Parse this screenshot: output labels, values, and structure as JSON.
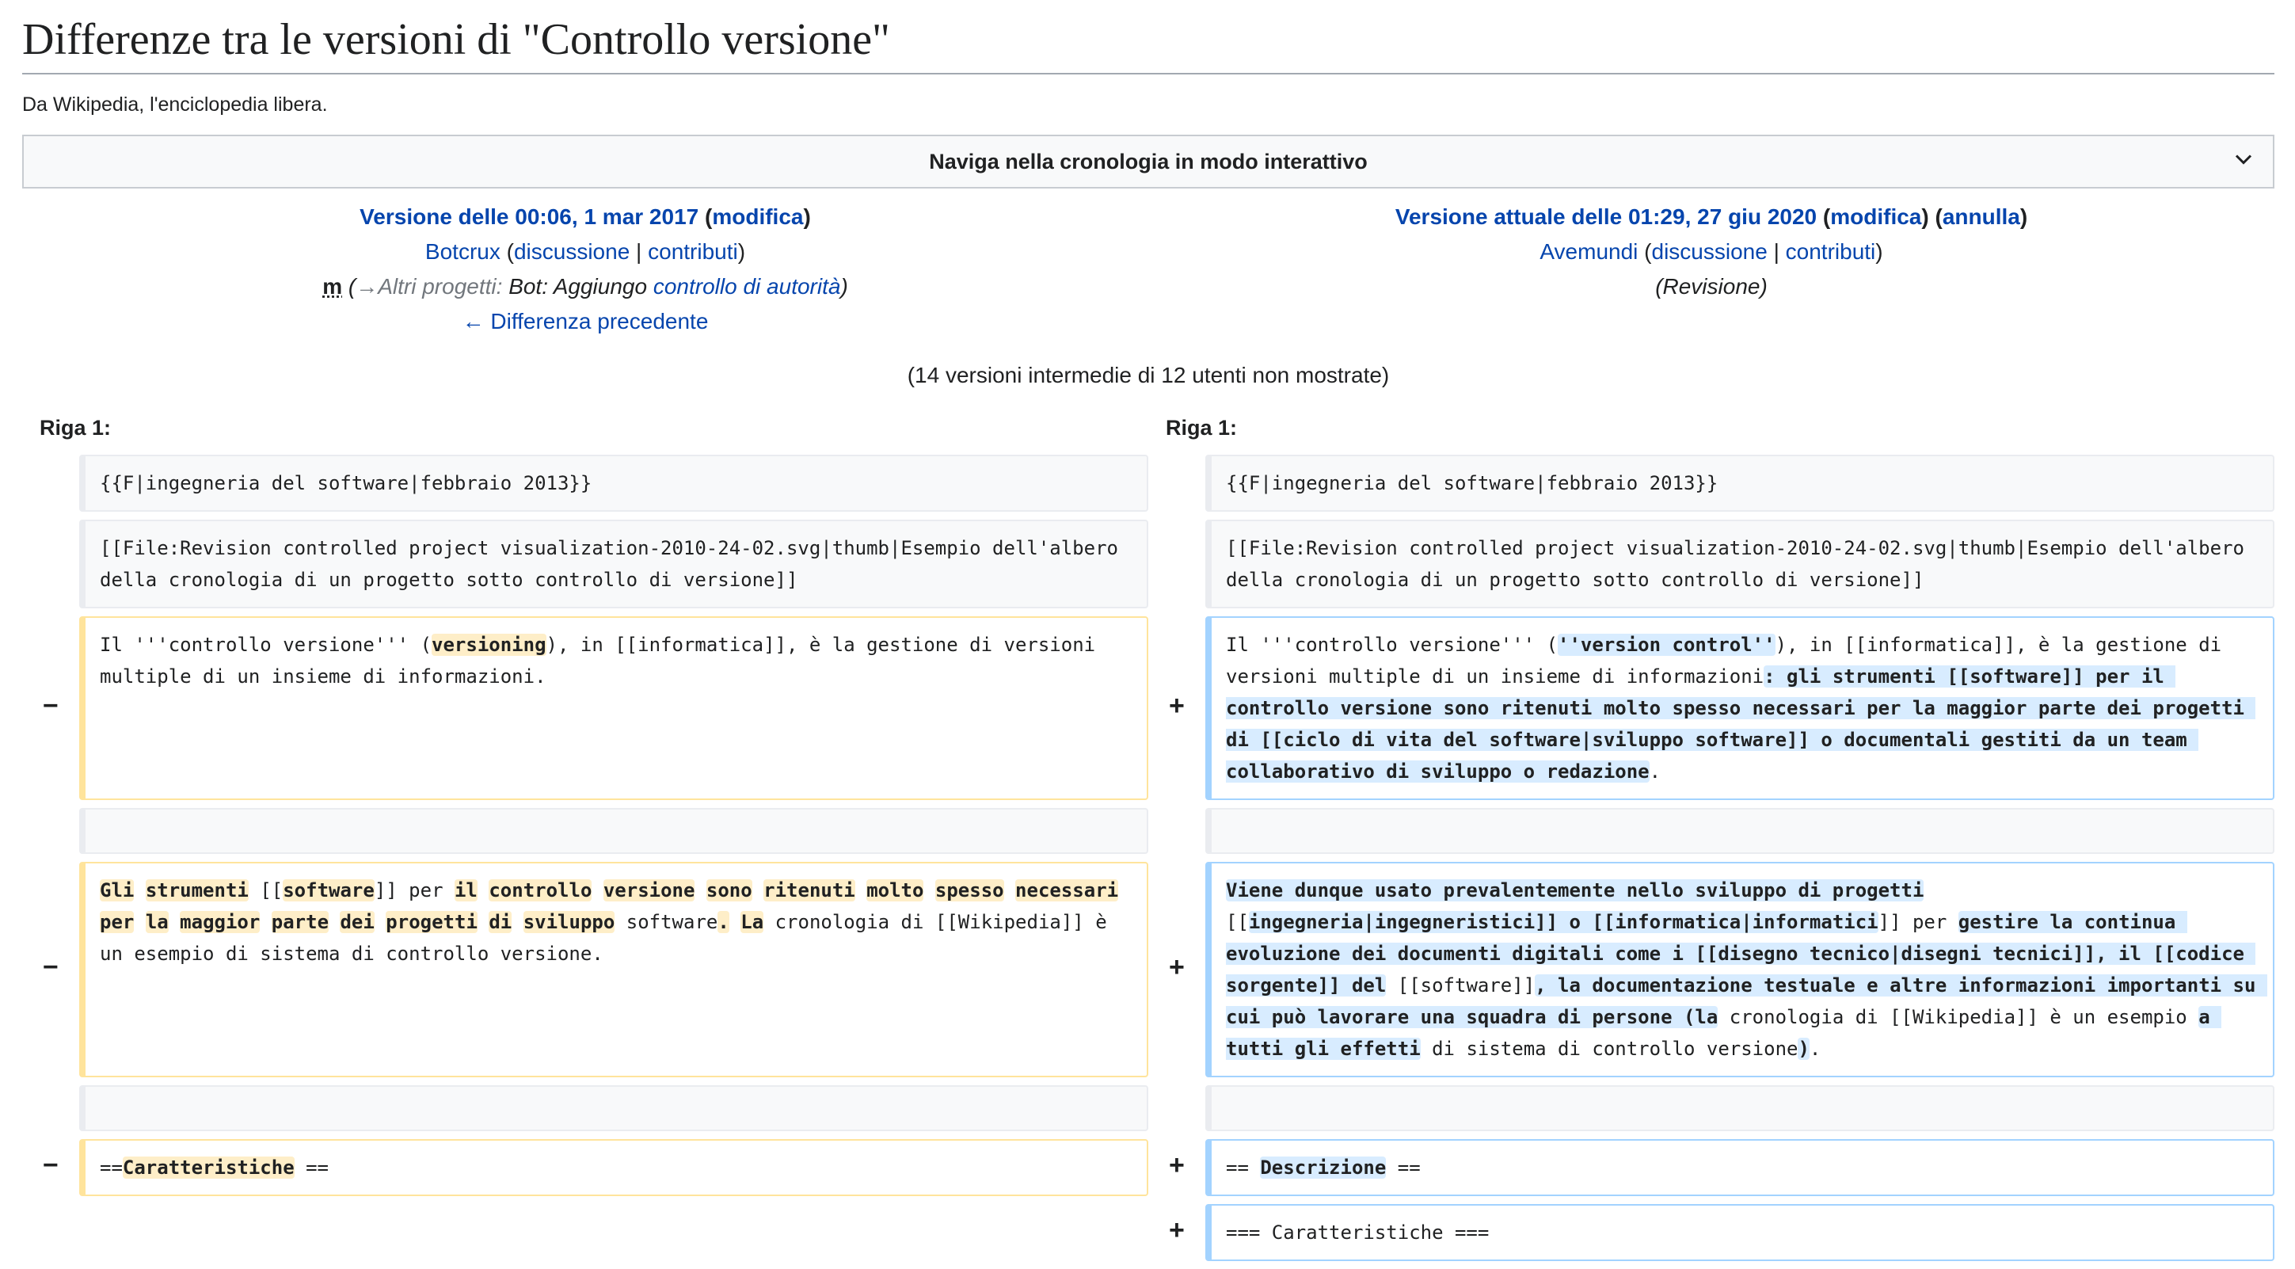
{
  "page": {
    "title": "Differenze tra le versioni di \"Controllo versione\"",
    "tagline": "Da Wikipedia, l'enciclopedia libera.",
    "navigate_label": "Naviga nella cronologia in modo interattivo"
  },
  "left": {
    "version_link": "Versione delle 00:06, 1 mar 2017",
    "edit_link": "modifica",
    "user": "Botcrux",
    "talk": "discussione",
    "contribs": "contributi",
    "minor": "m",
    "summary_arrow": "→",
    "summary_section": "Altri progetti:",
    "summary_text": "Bot: Aggiungo",
    "summary_link": "controllo di autorità",
    "prev_diff": "← Differenza precedente"
  },
  "right": {
    "version_link": "Versione attuale delle 01:29, 27 giu 2020",
    "edit_link": "modifica",
    "undo_link": "annulla",
    "user": "Avemundi",
    "talk": "discussione",
    "contribs": "contributi",
    "summary": "(Revisione)"
  },
  "intermediate": "(14 versioni intermedie di 12 utenti non mostrate)",
  "riga_label": "Riga 1:",
  "markers": {
    "minus": "−",
    "plus": "+"
  },
  "context": {
    "line1": "{{F|ingegneria del software|febbraio 2013}}",
    "line2": "[[File:Revision controlled project visualization-2010-24-02.svg|thumb|Esempio dell'albero della cronologia di un progetto sotto controllo di versione]]"
  },
  "del1": {
    "p1": "Il '''controllo versione''' (",
    "h1": "versioning",
    "p2": "), in [[informatica]], è la gestione di versioni multiple di un insieme di informazioni."
  },
  "add1": {
    "p1": "Il '''controllo versione''' (",
    "h1": "''version control''",
    "p2": "), in [[informatica]], è la gestione di versioni multiple di un insieme di informazioni",
    "h2": ": gli strumenti [[software]] per il controllo versione sono ritenuti molto spesso necessari per la maggior parte dei progetti di [[ciclo di vita del software|sviluppo software]] o documentali gestiti da un team collaborativo di sviluppo o redazione",
    "p3": "."
  },
  "del2": {
    "h1": "Gli",
    "h2": "strumenti",
    "h3": "software",
    "h4": "il",
    "h5": "controllo",
    "h6": "versione",
    "h7": "sono",
    "h8": "ritenuti",
    "h9": "molto",
    "h10": "spesso",
    "h11": "necessari",
    "h12": "per",
    "h13": "la",
    "h14": "maggior",
    "h15": "parte",
    "h16": "dei",
    "h17": "progetti",
    "h18": "di",
    "h19": "sviluppo",
    "h20": ".",
    "h21": "La",
    "t_open": "[[",
    "t_close": "]]",
    "t_per": "per",
    "t_software": "software",
    "t_cron": "cronologia di [[Wikipedia]] è un esempio di sistema di controllo versione."
  },
  "add2": {
    "h1": "Viene dunque usato prevalentemente nello sviluppo di progetti",
    "t1": "[[",
    "h2": "ingegneria|ingegneristici]] o [[informatica|informatici",
    "t2": "]] per",
    "h3": "gestire la continua evoluzione dei documenti digitali come i [[disegno tecnico|disegni tecnici]], il [[codice sorgente]] del",
    "t3": "[[software]]",
    "h4": ", la documentazione testuale e altre informazioni importanti su cui può lavorare una squadra di persone (la",
    "t4": "cronologia di [[Wikipedia]] è un esempio",
    "h5": "a tutti gli effetti",
    "t5": "di sistema di controllo versione",
    "h6": ")",
    "t6": "."
  },
  "del3": {
    "p1": "==",
    "h1": "Caratteristiche",
    "p2": " =="
  },
  "add3": {
    "p1": "== ",
    "h1": "Descrizione",
    "p2": " =="
  },
  "add4": {
    "p1": "=== Caratteristiche ==="
  }
}
